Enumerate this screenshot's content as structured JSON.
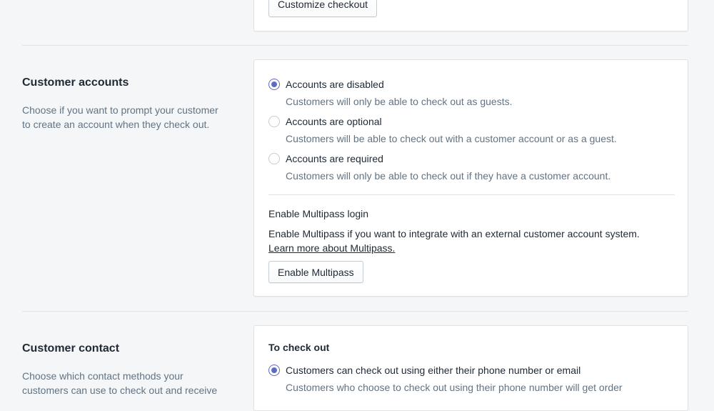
{
  "checkout_section": {
    "customize_button": "Customize checkout"
  },
  "customer_accounts": {
    "title": "Customer accounts",
    "description": "Choose if you want to prompt your customer to create an account when they check out.",
    "options": [
      {
        "label": "Accounts are disabled",
        "help": "Customers will only be able to check out as guests.",
        "checked": true
      },
      {
        "label": "Accounts are optional",
        "help": "Customers will be able to check out with a customer account or as a guest.",
        "checked": false
      },
      {
        "label": "Accounts are required",
        "help": "Customers will only be able to check out if they have a customer account.",
        "checked": false
      }
    ],
    "multipass": {
      "heading": "Enable Multipass login",
      "text": "Enable Multipass if you want to integrate with an external customer account system.",
      "link": "Learn more about Multipass.",
      "button": "Enable Multipass"
    }
  },
  "customer_contact": {
    "title": "Customer contact",
    "description": "Choose which contact methods your customers can use to check out and receive",
    "subheading": "To check out",
    "options": [
      {
        "label": "Customers can check out using either their phone number or email",
        "help": "Customers who choose to check out using their phone number will get order",
        "checked": true
      }
    ]
  },
  "colors": {
    "accent": "#5c6ac4",
    "background": "#f4f6f8",
    "card": "#ffffff",
    "border": "#dfe3e8",
    "subdued_text": "#637381"
  }
}
